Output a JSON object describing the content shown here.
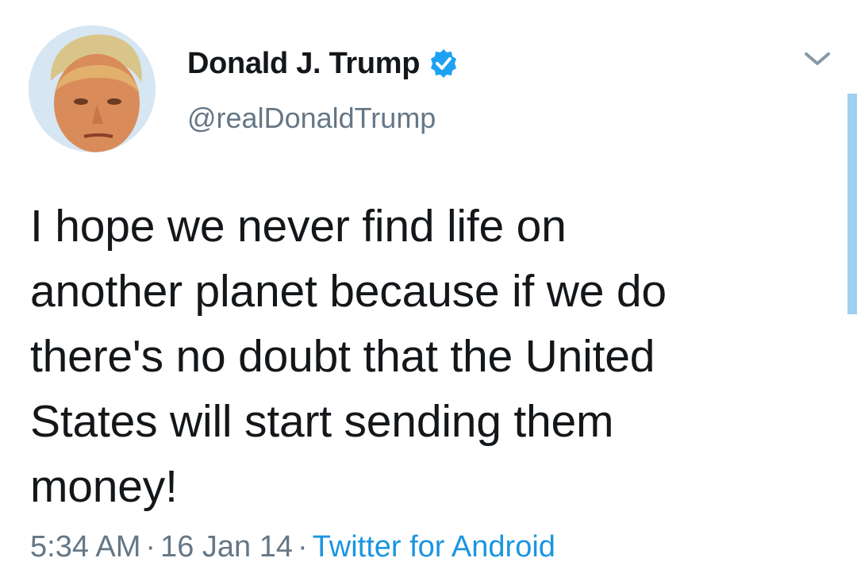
{
  "user": {
    "name": "Donald J. Trump",
    "handle": "@realDonaldTrump",
    "verified": true,
    "avatar_icon": "profile-photo"
  },
  "tweet": {
    "text": "I hope we never find life on\nanother planet because if we do\nthere's no doubt that the United\nStates will start sending them\nmoney!",
    "time": "5:34 AM",
    "date": "16 Jan 14",
    "separator": "·",
    "source": "Twitter for Android"
  },
  "icons": {
    "verified": "verified-badge-icon",
    "menu": "chevron-down-icon"
  },
  "colors": {
    "text": "#14171a",
    "secondary": "#657786",
    "link": "#1b95e0",
    "verified": "#1da1f2",
    "scrollbar": "#9fd0f3"
  }
}
